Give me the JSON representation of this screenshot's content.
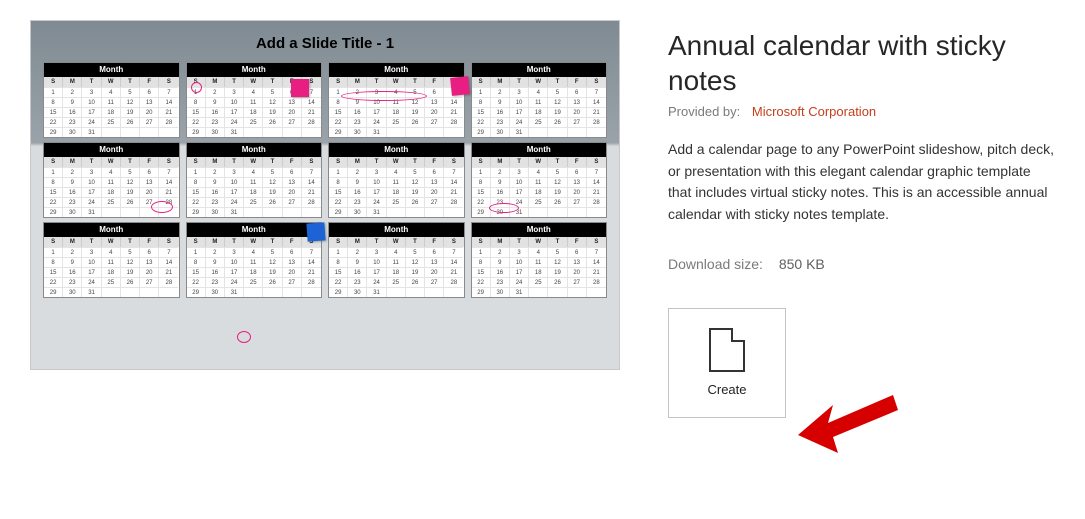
{
  "preview": {
    "slide_title": "Add a Slide Title - 1",
    "month_label": "Month",
    "dow": [
      "S",
      "M",
      "T",
      "W",
      "T",
      "F",
      "S"
    ]
  },
  "template": {
    "title": "Annual calendar with sticky notes",
    "provided_by_label": "Provided by:",
    "provided_by_link": "Microsoft Corporation",
    "description": "Add a calendar page to any PowerPoint slideshow, pitch deck, or presentation with this elegant calendar graphic template that includes virtual sticky notes. This is an accessible annual calendar with sticky notes template.",
    "download_size_label": "Download size:",
    "download_size_value": "850 KB",
    "create_button_label": "Create"
  },
  "annotation": {
    "arrow_color": "#d60000"
  }
}
